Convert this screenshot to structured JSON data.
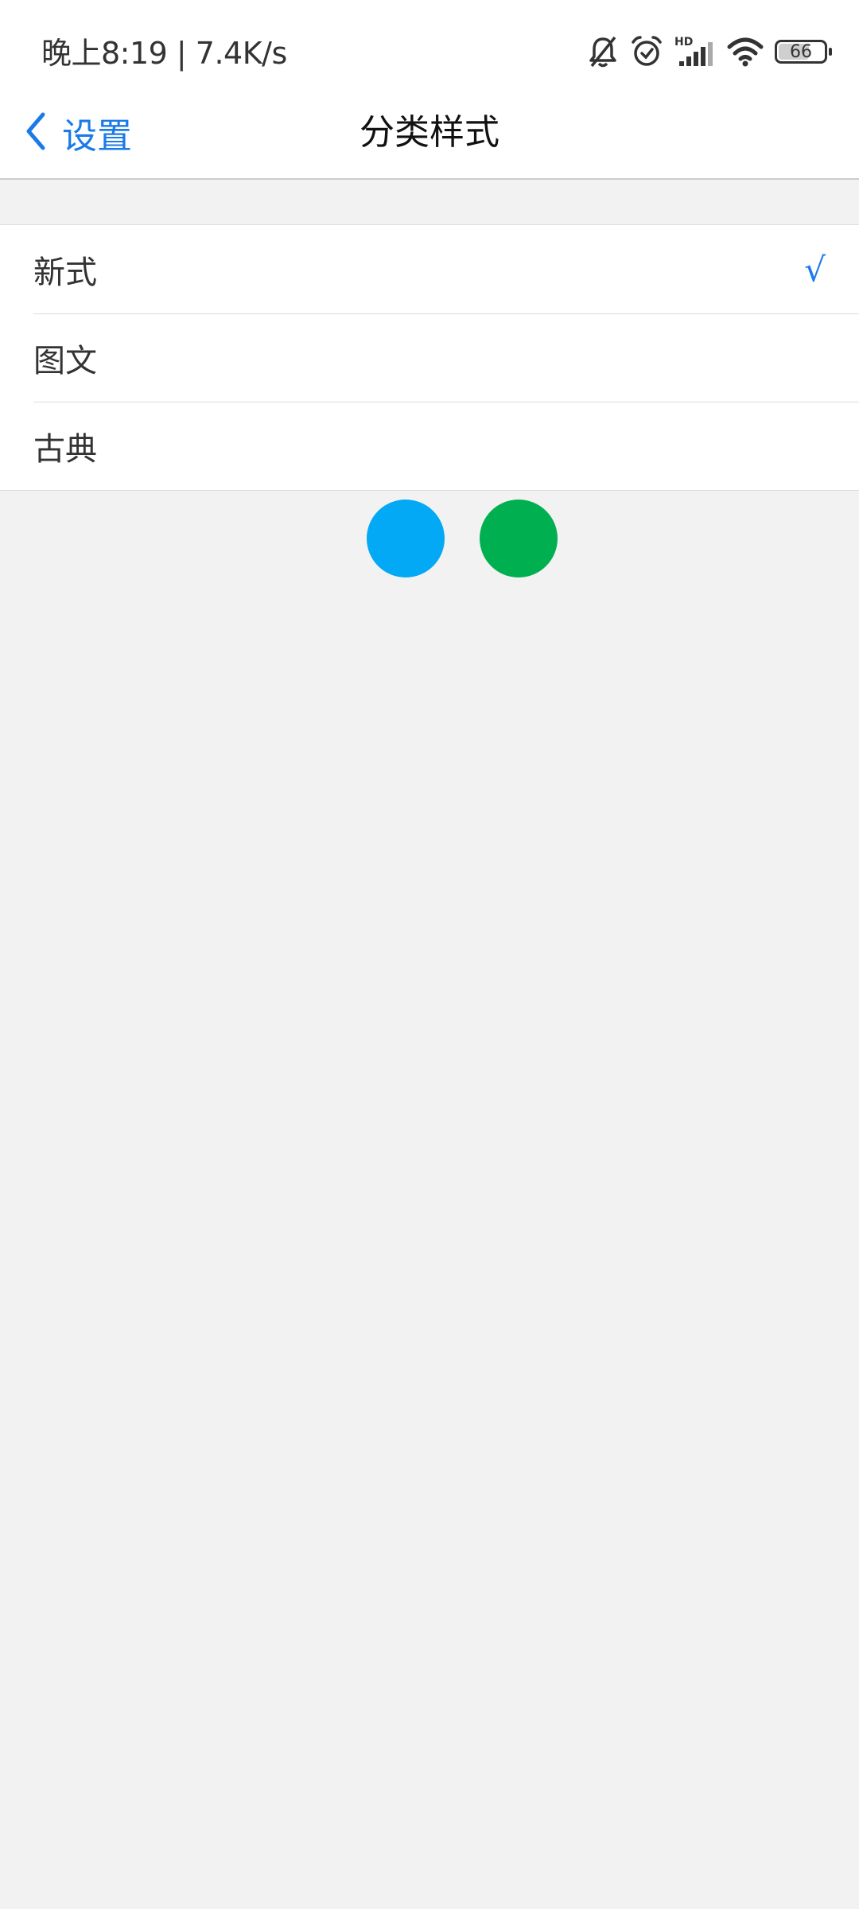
{
  "status_bar": {
    "time_speed": "晚上8:19 | 7.4K/s",
    "icons": [
      "bell-muted-icon",
      "alarm-icon",
      "hd-signal-icon",
      "wifi-icon",
      "battery-icon"
    ],
    "battery_level": "66"
  },
  "nav": {
    "back_label": "设置",
    "title": "分类样式"
  },
  "options": {
    "items": [
      {
        "label": "新式",
        "selected": true
      },
      {
        "label": "图文",
        "selected": false
      },
      {
        "label": "古典",
        "selected": false
      }
    ],
    "check_mark": "√"
  },
  "loading_dots": {
    "colors": [
      "#03a9f4",
      "#00b050"
    ]
  },
  "colors": {
    "accent": "#1a7ae8",
    "background": "#f2f2f2"
  }
}
